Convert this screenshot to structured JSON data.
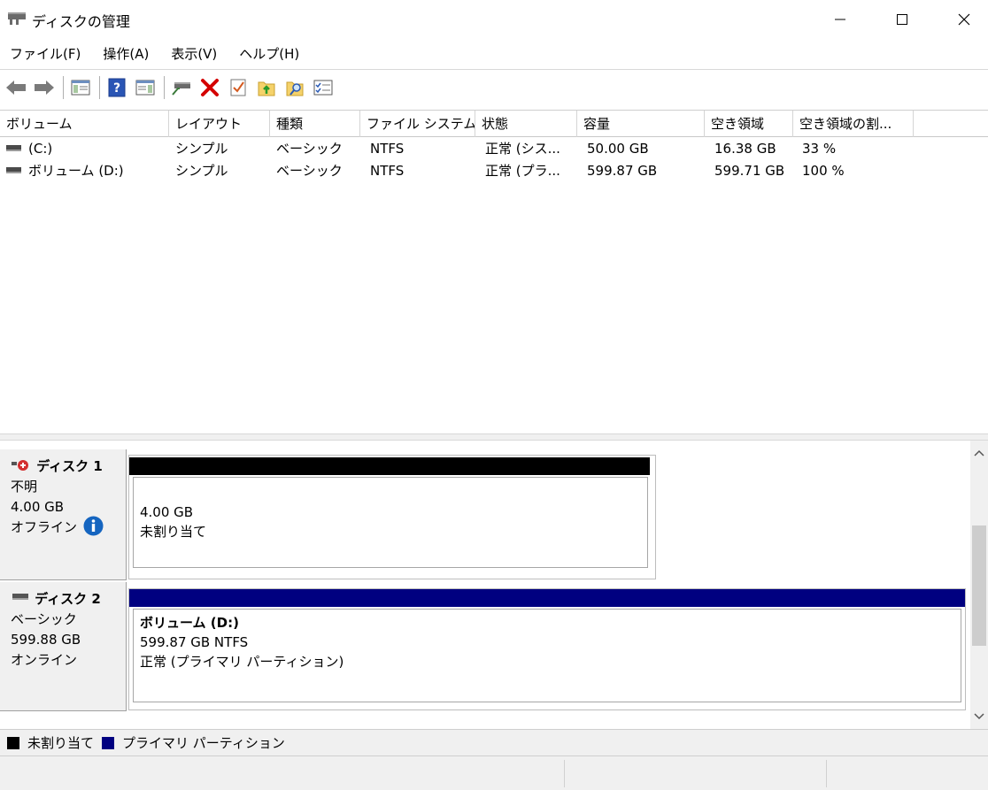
{
  "window": {
    "title": "ディスクの管理",
    "minimize_icon": "minimize-icon",
    "maximize_icon": "maximize-icon",
    "close_icon": "close-icon"
  },
  "menu": [
    "ファイル(F)",
    "操作(A)",
    "表示(V)",
    "ヘルプ(H)"
  ],
  "toolbar": [
    "back-arrow-icon",
    "forward-arrow-icon",
    "console-tree-icon",
    "help-icon",
    "show-action-pane-icon",
    "connect-drive-icon",
    "delete-icon",
    "checklist-icon",
    "folder-up-icon",
    "folder-search-icon",
    "properties-icon"
  ],
  "volume_list": {
    "columns": [
      "ボリューム",
      "レイアウト",
      "種類",
      "ファイル システム",
      "状態",
      "容量",
      "空き領域",
      "空き領域の割..."
    ],
    "rows": [
      [
        "(C:)",
        "シンプル",
        "ベーシック",
        "NTFS",
        "正常 (シス...",
        "50.00 GB",
        "16.38 GB",
        "33 %"
      ],
      [
        "ボリューム (D:)",
        "シンプル",
        "ベーシック",
        "NTFS",
        "正常 (プラ...",
        "599.87 GB",
        "599.71 GB",
        "100 %"
      ]
    ]
  },
  "disks": {
    "disk1": {
      "name": "ディスク 1",
      "type": "不明",
      "size": "4.00 GB",
      "status": "オフライン",
      "partition": {
        "size": "4.00 GB",
        "label": "未割り当て"
      }
    },
    "disk2": {
      "name": "ディスク 2",
      "type": "ベーシック",
      "size": "599.88 GB",
      "status": "オンライン",
      "partition": {
        "name": "ボリューム (D:)",
        "detail": "599.87 GB NTFS",
        "state": "正常 (プライマリ パーティション)"
      }
    }
  },
  "legend": [
    {
      "label": "未割り当て",
      "color": "#000000"
    },
    {
      "label": "プライマリ パーティション",
      "color": "#000080"
    }
  ],
  "colors": {
    "primary_partition": "#000080",
    "unallocated": "#000000",
    "info": "#1565c0"
  }
}
